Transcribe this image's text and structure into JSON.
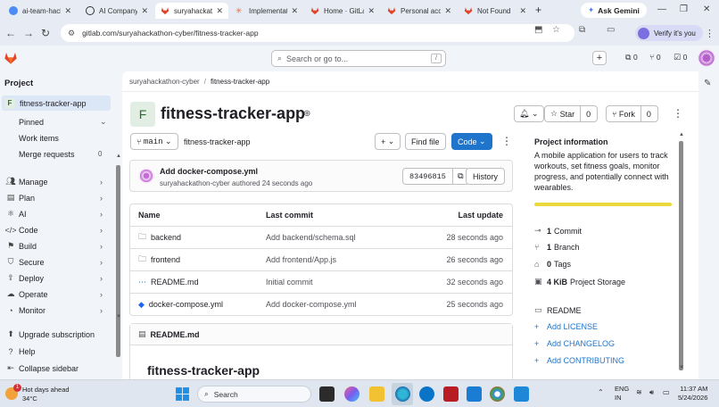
{
  "browser": {
    "tabs": [
      {
        "title": "ai-team-hack",
        "color": "#4c8bf5"
      },
      {
        "title": "AI Company",
        "color": "#333333"
      },
      {
        "title": "suryahackath",
        "color": "#e24329"
      },
      {
        "title": "Implementati",
        "color": "#f06a35"
      },
      {
        "title": "Home · GitLa",
        "color": "#e24329"
      },
      {
        "title": "Personal acce",
        "color": "#e24329"
      },
      {
        "title": "Not Found",
        "color": "#e24329"
      }
    ],
    "active_tab": 2,
    "new_tab": "+",
    "ask_gemini": "Ask Gemini",
    "url": "gitlab.com/suryahackathon-cyber/fitness-tracker-app",
    "verify": "Verify it's you"
  },
  "gitlab_top": {
    "search_placeholder": "Search or go to...",
    "search_shortcut": "/",
    "counts": {
      "issues": "0",
      "merge_requests": "0",
      "todos": "0"
    }
  },
  "sidebar": {
    "heading": "Project",
    "project_letter": "F",
    "project_name": "fitness-tracker-app",
    "pinned": "Pinned",
    "pinned_items": [
      {
        "label": "Work items",
        "count": ""
      },
      {
        "label": "Merge requests",
        "count": "0"
      }
    ],
    "sections": [
      "Manage",
      "Plan",
      "AI",
      "Code",
      "Build",
      "Secure",
      "Deploy",
      "Operate",
      "Monitor"
    ],
    "bottom": [
      "Upgrade subscription",
      "Help",
      "Collapse sidebar"
    ]
  },
  "main": {
    "breadcrumb": [
      "suryahackathon-cyber",
      "fitness-tracker-app"
    ],
    "project_letter": "F",
    "title": "fitness-tracker-app",
    "star_label": "Star",
    "star_count": "0",
    "fork_label": "Fork",
    "fork_count": "0",
    "branch": "main",
    "path": "fitness-tracker-app",
    "find_file": "Find file",
    "code_button": "Code",
    "last_commit": {
      "message": "Add docker-compose.yml",
      "author": "suryahackathon-cyber",
      "meta": "authored 24 seconds ago",
      "sha": "83496815",
      "history": "History"
    },
    "table": {
      "headers": [
        "Name",
        "Last commit",
        "Last update"
      ],
      "rows": [
        {
          "icon": "folder-icon",
          "name": "backend",
          "commit": "Add backend/schema.sql",
          "updated": "28 seconds ago"
        },
        {
          "icon": "folder-icon",
          "name": "frontend",
          "commit": "Add frontend/App.js",
          "updated": "26 seconds ago"
        },
        {
          "icon": "markdown-icon",
          "name": "README.md",
          "commit": "Initial commit",
          "updated": "32 seconds ago"
        },
        {
          "icon": "docker-icon",
          "name": "docker-compose.yml",
          "commit": "Add docker-compose.yml",
          "updated": "25 seconds ago"
        }
      ]
    },
    "readme": {
      "filename": "README.md",
      "heading": "fitness-tracker-app"
    },
    "project_info": {
      "title": "Project information",
      "description": "A mobile application for users to track workouts, set fitness goals, monitor progress, and potentially connect with wearables.",
      "language_color": "#e9d93b",
      "stats": [
        {
          "icon": "commit-icon",
          "value": "1",
          "label": "Commit"
        },
        {
          "icon": "branch-icon",
          "value": "1",
          "label": "Branch"
        },
        {
          "icon": "tag-icon",
          "value": "0",
          "label": "Tags"
        },
        {
          "icon": "storage-icon",
          "value": "4 KiB",
          "label": "Project Storage"
        }
      ],
      "readme_link": "README",
      "add_links": [
        "Add LICENSE",
        "Add CHANGELOG",
        "Add CONTRIBUTING"
      ]
    }
  },
  "taskbar": {
    "weather_title": "Hot days ahead",
    "weather_temp": "34°C",
    "weather_badge": "1",
    "search": "Search",
    "lang1": "ENG",
    "lang2": "IN",
    "time": "11:37 AM",
    "date": "5/24/2026"
  }
}
